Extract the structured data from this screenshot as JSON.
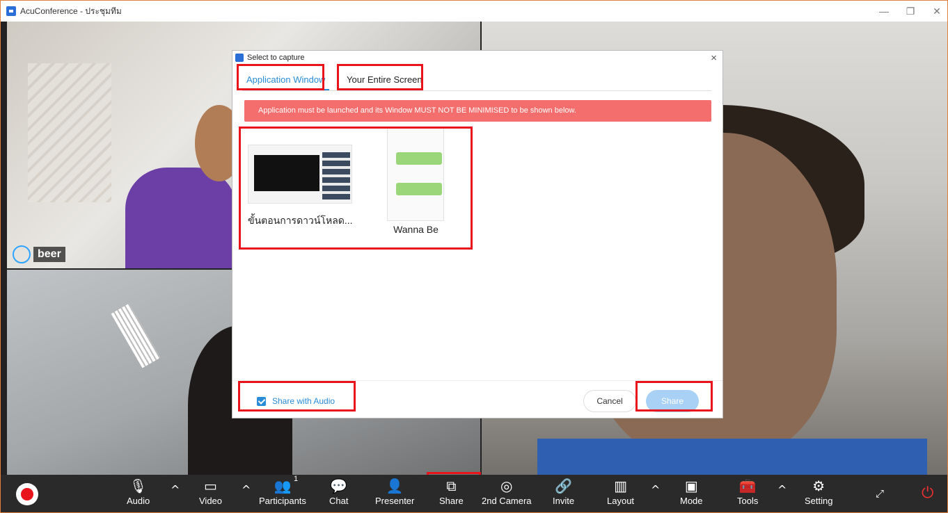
{
  "window": {
    "title": "AcuConference - ประชุมทีม",
    "minimize": "—",
    "restore": "❐",
    "close": "✕"
  },
  "participant_tag": {
    "name": "beer",
    "mic_icon": "microphone-icon"
  },
  "dialog": {
    "title": "Select to capture",
    "close": "×",
    "tabs": [
      {
        "label": "Application Window",
        "active": true
      },
      {
        "label": "Your Entire Screen",
        "active": false
      }
    ],
    "warning": "Application must be launched and its Window MUST NOT BE MINIMISED to be shown below.",
    "windows": [
      {
        "label": "ขั้นตอนการดาวน์โหลด..."
      },
      {
        "label": "Wanna Be"
      }
    ],
    "share_audio": {
      "label": "Share with Audio",
      "checked": true
    },
    "cancel_label": "Cancel",
    "share_label": "Share"
  },
  "toolbar": {
    "items": [
      {
        "label": "Audio",
        "icon": "microphone-icon"
      },
      {
        "label": "Video",
        "icon": "video-camera-icon"
      },
      {
        "label": "Participants",
        "icon": "participants-icon",
        "count": "1"
      },
      {
        "label": "Chat",
        "icon": "chat-icon"
      },
      {
        "label": "Presenter",
        "icon": "presenter-icon"
      },
      {
        "label": "Share",
        "icon": "share-screen-icon"
      },
      {
        "label": "2nd Camera",
        "icon": "webcam-icon"
      },
      {
        "label": "Invite",
        "icon": "invite-link-icon"
      },
      {
        "label": "Layout",
        "icon": "layout-icon"
      },
      {
        "label": "Mode",
        "icon": "mode-icon"
      },
      {
        "label": "Tools",
        "icon": "tools-icon"
      },
      {
        "label": "Setting",
        "icon": "gear-icon"
      }
    ],
    "caret": "^",
    "expand": "⤢",
    "leave": "⏻"
  },
  "colors": {
    "accent": "#2a8bd6",
    "warning_bg": "#f46e6e",
    "highlight": "#e8131b",
    "toolbar_bg": "#2a2a2a",
    "share_disabled": "#a8d1f5"
  }
}
